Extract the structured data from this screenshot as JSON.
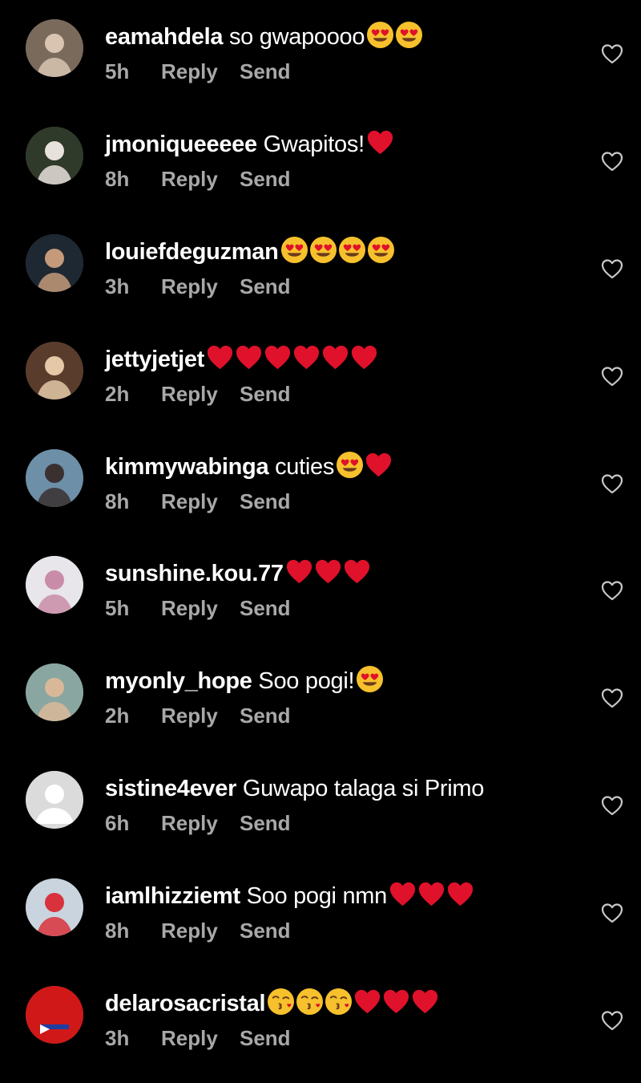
{
  "colors": {
    "background": "#000000",
    "text": "#ffffff",
    "meta": "#a8a8a8",
    "heart": "#e0112b",
    "emoji_face": "#f6c12c"
  },
  "comments": [
    {
      "username": "eamahdela",
      "text": "so gwapoooo",
      "emojis": [
        "heart-eyes",
        "heart-eyes"
      ],
      "time": "5h",
      "reply": "Reply",
      "send": "Send",
      "avatar": {
        "bg": "#7a6a5c",
        "fg": "#d8c4b0",
        "style": "photo"
      }
    },
    {
      "username": "jmoniqueeeee",
      "text": "Gwapitos!",
      "emojis": [
        "red-heart"
      ],
      "time": "8h",
      "reply": "Reply",
      "send": "Send",
      "avatar": {
        "bg": "#2f3a2a",
        "fg": "#e8e2dc",
        "style": "photo"
      }
    },
    {
      "username": "louiefdeguzman",
      "text": "",
      "emojis": [
        "heart-eyes",
        "heart-eyes",
        "heart-eyes",
        "heart-eyes"
      ],
      "time": "3h",
      "reply": "Reply",
      "send": "Send",
      "avatar": {
        "bg": "#1e2833",
        "fg": "#c49a7a",
        "style": "photo"
      }
    },
    {
      "username": "jettyjetjet",
      "text": "",
      "emojis": [
        "red-heart",
        "red-heart",
        "red-heart",
        "red-heart",
        "red-heart",
        "red-heart"
      ],
      "time": "2h",
      "reply": "Reply",
      "send": "Send",
      "avatar": {
        "bg": "#5a3c2c",
        "fg": "#e4c8a8",
        "style": "photo"
      }
    },
    {
      "username": "kimmywabinga",
      "text": "cuties",
      "emojis": [
        "heart-eyes",
        "red-heart"
      ],
      "time": "8h",
      "reply": "Reply",
      "send": "Send",
      "avatar": {
        "bg": "#6d8fa8",
        "fg": "#3a3030",
        "style": "photo"
      }
    },
    {
      "username": "sunshine.kou.77",
      "text": "",
      "emojis": [
        "red-heart",
        "red-heart",
        "red-heart"
      ],
      "time": "5h",
      "reply": "Reply",
      "send": "Send",
      "avatar": {
        "bg": "#e8e6ea",
        "fg": "#c98ca8",
        "style": "photo"
      }
    },
    {
      "username": "myonly_hope",
      "text": "Soo pogi!",
      "emojis": [
        "heart-eyes"
      ],
      "time": "2h",
      "reply": "Reply",
      "send": "Send",
      "avatar": {
        "bg": "#8aa6a0",
        "fg": "#d9b89a",
        "style": "photo"
      }
    },
    {
      "username": "sistine4ever",
      "text": "Guwapo talaga si Primo",
      "emojis": [],
      "time": "6h",
      "reply": "Reply",
      "send": "Send",
      "avatar": {
        "bg": "#dbdbdb",
        "fg": "#ffffff",
        "style": "default"
      }
    },
    {
      "username": "iamlhizziemt",
      "text": "Soo pogi nmn",
      "emojis": [
        "red-heart",
        "red-heart",
        "red-heart"
      ],
      "time": "8h",
      "reply": "Reply",
      "send": "Send",
      "avatar": {
        "bg": "#c9d4de",
        "fg": "#d8323c",
        "style": "photo"
      }
    },
    {
      "username": "delarosacristal",
      "text": "",
      "emojis": [
        "kissing-face",
        "kissing-face",
        "kissing-face",
        "red-heart",
        "red-heart",
        "red-heart"
      ],
      "time": "3h",
      "reply": "Reply",
      "send": "Send",
      "avatar": {
        "bg": "#d01818",
        "fg": "#1f3fa0",
        "style": "flag"
      }
    }
  ]
}
